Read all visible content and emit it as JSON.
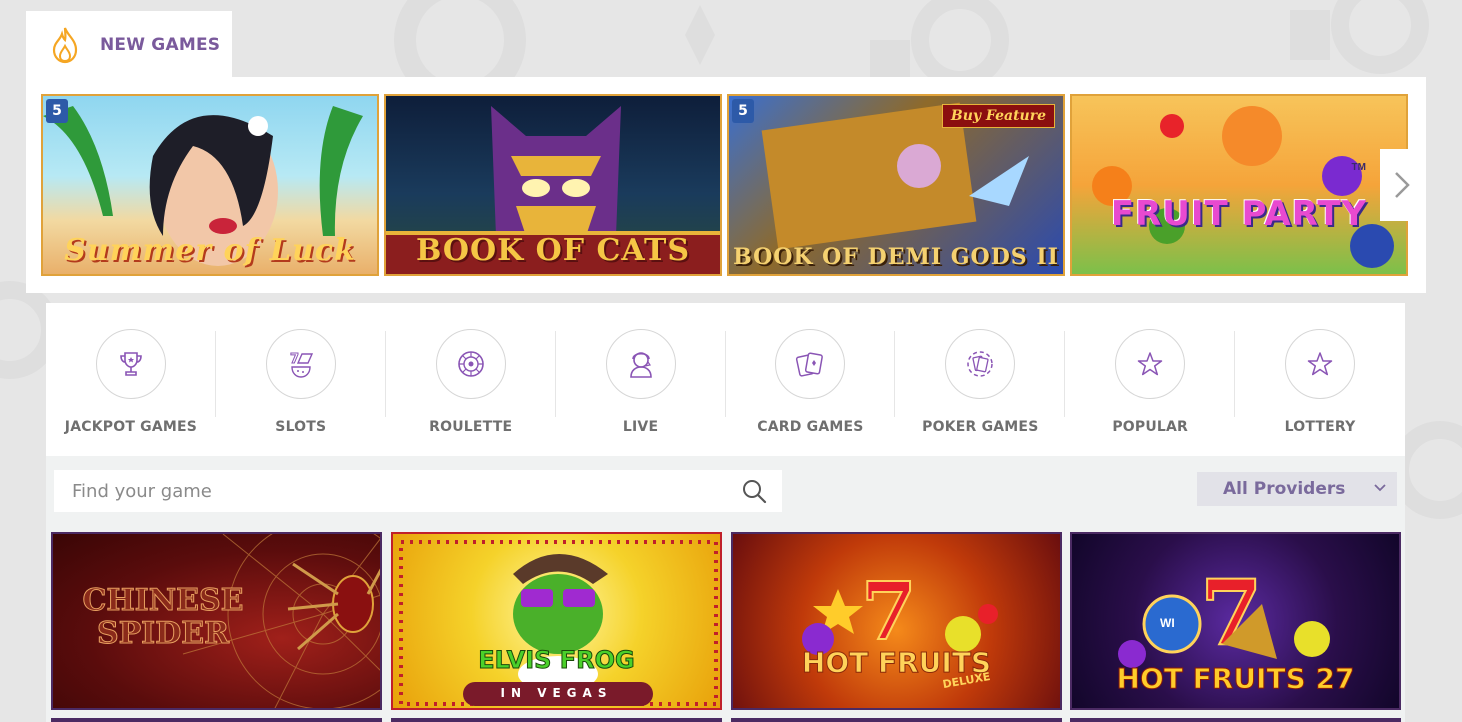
{
  "colors": {
    "accent_purple": "#7a5a9c",
    "flame_orange": "#f5a623",
    "card_border_gold": "#e0a23a",
    "game_border": "#4b2a63"
  },
  "new_games": {
    "title": "NEW GAMES",
    "icon": "flame-icon",
    "cards": [
      {
        "label": "Summer of Luck",
        "badge": "5"
      },
      {
        "label": "BOOK OF CATS",
        "badge": ""
      },
      {
        "label": "BOOK OF DEMI GODS II",
        "badge": "5",
        "tag": "Buy Feature"
      },
      {
        "label": "FRUIT PARTY",
        "badge": "",
        "tm": "TM"
      }
    ],
    "next_icon": "chevron-right-icon"
  },
  "categories": [
    {
      "label": "JACKPOT GAMES",
      "icon": "trophy-icon"
    },
    {
      "label": "SLOTS",
      "icon": "slots-icon"
    },
    {
      "label": "ROULETTE",
      "icon": "roulette-icon"
    },
    {
      "label": "LIVE",
      "icon": "live-dealer-icon"
    },
    {
      "label": "CARD GAMES",
      "icon": "cards-icon"
    },
    {
      "label": "POKER GAMES",
      "icon": "poker-icon"
    },
    {
      "label": "POPULAR",
      "icon": "star-icon"
    },
    {
      "label": "LOTTERY",
      "icon": "star-icon"
    }
  ],
  "search": {
    "placeholder": "Find your game",
    "value": "",
    "icon": "search-icon"
  },
  "providers": {
    "selected": "All Providers",
    "icon": "chevron-down-icon"
  },
  "games": [
    {
      "label": "CHINESE SPIDER"
    },
    {
      "label": "ELVIS FROG",
      "sub": "IN VEGAS"
    },
    {
      "label": "HOT FRUITS",
      "sub": "DELUXE"
    },
    {
      "label": "HOT FRUITS 27",
      "badge": "WI"
    }
  ]
}
